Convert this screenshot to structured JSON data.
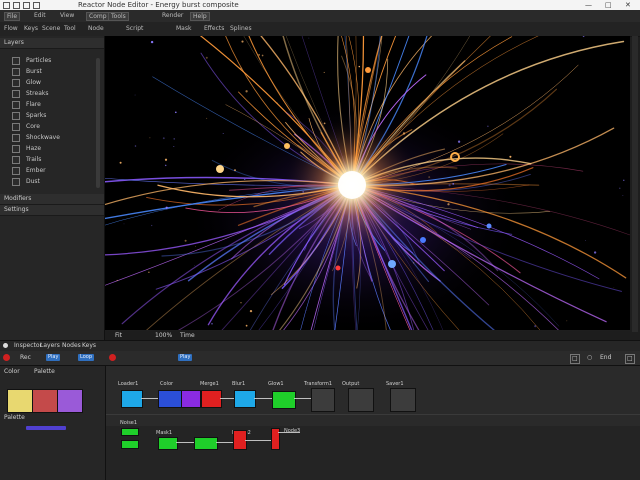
{
  "titlebar": {
    "title": "Reactor Node Editor - Energy burst composite",
    "minimize": "—",
    "maximize": "□",
    "close": "✕"
  },
  "toolbar": {
    "buttons": [
      "File",
      "Edit",
      "View",
      "Comp",
      "Tools",
      "Render",
      "Help"
    ]
  },
  "menubar": {
    "items": [
      "Flow",
      "Keys",
      "Scene",
      "Tool",
      "Node",
      "Script",
      "Mask",
      "Effects",
      "Splines"
    ]
  },
  "left_panel": {
    "header": "Layers",
    "rows": [
      "Particles",
      "Burst",
      "Glow",
      "Streaks",
      "Flare",
      "Sparks",
      "Core",
      "Shockwave",
      "Haze",
      "Trails",
      "Ember",
      "Dust"
    ],
    "footer_headers": [
      "Modifiers",
      "Settings"
    ]
  },
  "bottombar": {
    "labels": [
      "Inspector",
      "Layers",
      "Nodes",
      "Keys"
    ],
    "viewer_buttons": [
      "Fit",
      "100%",
      "Time"
    ]
  },
  "timeline": {
    "record_label": "Rec",
    "blue_button_1": "Play",
    "blue_button_2": "Loop",
    "end_button": "End"
  },
  "swatch_panel": {
    "header_labels": [
      "Color",
      "Palette"
    ],
    "swatch_colors": [
      "#e8d870",
      "#c44a4a",
      "#9a5ad8"
    ],
    "footer_label": "Palette"
  },
  "node_graph": {
    "row1_labels": [
      "Loader1",
      "Color",
      "Merge1",
      "Blur1",
      "Glow1",
      "Transform1",
      "Output",
      "Saver1"
    ],
    "row2_labels": [
      "Noise1",
      "Mask1",
      "Merge2",
      "Node3"
    ],
    "node_colors": {
      "cyan": "#1ea8e8",
      "blue": "#2b4fd8",
      "purple": "#8a2be2",
      "red": "#e02020",
      "green": "#1fcf2a",
      "gray": "#3c3c3c"
    }
  },
  "viewer": {
    "background": "#000000",
    "burst_core": "#fff6d8",
    "accent_warm": "#ff9a3a",
    "accent_cool": "#7a5aff",
    "accent_blue": "#3a7aff"
  }
}
